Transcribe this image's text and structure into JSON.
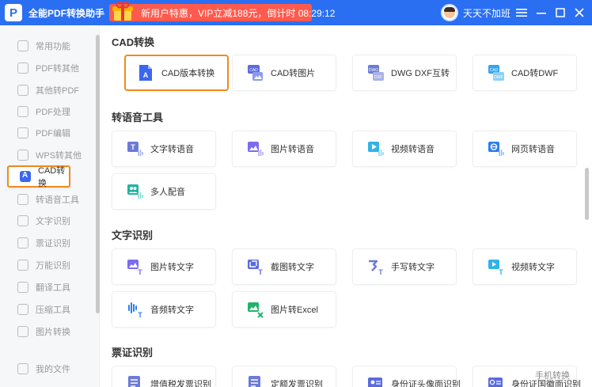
{
  "app": {
    "title": "全能PDF转换助手"
  },
  "promo": {
    "text": "新用户特惠，VIP立减188元，倒计时 08:29:12"
  },
  "user": {
    "name": "天天不加班"
  },
  "window_controls": [
    "minimize-icon",
    "maximize-icon",
    "close-icon"
  ],
  "sidebar": {
    "items": [
      {
        "label": "常用功能",
        "icon": "star-icon"
      },
      {
        "label": "PDF转其他",
        "icon": "pdf-icon"
      },
      {
        "label": "其他转PDF",
        "icon": "convert-icon"
      },
      {
        "label": "PDF处理",
        "icon": "tools-icon"
      },
      {
        "label": "PDF编辑",
        "icon": "edit-icon"
      },
      {
        "label": "WPS转其他",
        "icon": "wps-icon"
      },
      {
        "label": "CAD转换",
        "icon": "cad-icon",
        "active": true
      },
      {
        "label": "转语音工具",
        "icon": "audio-icon"
      },
      {
        "label": "文字识别",
        "icon": "text-icon"
      },
      {
        "label": "票证识别",
        "icon": "ticket-icon"
      },
      {
        "label": "万能识别",
        "icon": "scan-icon"
      },
      {
        "label": "翻译工具",
        "icon": "translate-icon"
      },
      {
        "label": "压缩工具",
        "icon": "compress-icon"
      },
      {
        "label": "图片转换",
        "icon": "image-icon"
      },
      {
        "label": "我的文件",
        "icon": "folder-icon"
      }
    ]
  },
  "sections": [
    {
      "title": "CAD转换",
      "cards": [
        {
          "label": "CAD版本转换",
          "icon": "cad-version-icon",
          "color": "#3a66f0"
        },
        {
          "label": "CAD转图片",
          "icon": "cad-to-image-icon",
          "color": "#5b6be0"
        },
        {
          "label": "DWG DXF互转",
          "icon": "dwg-dxf-icon",
          "color": "#6b7bd6"
        },
        {
          "label": "CAD转DWF",
          "icon": "cad-to-dwf-icon",
          "color": "#2fa7f0"
        }
      ]
    },
    {
      "title": "转语音工具",
      "cards": [
        {
          "label": "文字转语音",
          "icon": "text-to-speech-icon",
          "color": "#6b7bd6"
        },
        {
          "label": "图片转语音",
          "icon": "image-to-speech-icon",
          "color": "#7c6cf0"
        },
        {
          "label": "视频转语音",
          "icon": "video-to-speech-icon",
          "color": "#2fb4e8"
        },
        {
          "label": "网页转语音",
          "icon": "web-to-speech-icon",
          "color": "#2b7ff0"
        },
        {
          "label": "多人配音",
          "icon": "multi-dubbing-icon",
          "color": "#21b3a2"
        }
      ]
    },
    {
      "title": "文字识别",
      "cards": [
        {
          "label": "图片转文字",
          "icon": "image-to-text-icon",
          "color": "#7c6cf0"
        },
        {
          "label": "截图转文字",
          "icon": "screenshot-to-text-icon",
          "color": "#5b6be0"
        },
        {
          "label": "手写转文字",
          "icon": "handwriting-to-text-icon",
          "color": "#6b7bd6"
        },
        {
          "label": "视频转文字",
          "icon": "video-to-text-icon",
          "color": "#2fb4e8"
        },
        {
          "label": "音频转文字",
          "icon": "audio-to-text-icon",
          "color": "#2b7ff0"
        },
        {
          "label": "图片转Excel",
          "icon": "image-to-excel-icon",
          "color": "#23b26b"
        }
      ]
    },
    {
      "title": "票证识别",
      "cards": [
        {
          "label": "增值税发票识别",
          "icon": "invoice-icon",
          "color": "#6b7bd6"
        },
        {
          "label": "定额发票识别",
          "icon": "quota-invoice-icon",
          "color": "#6b7bd6"
        },
        {
          "label": "身份证头像面识别",
          "icon": "id-front-icon",
          "color": "#5b6be0"
        },
        {
          "label": "身份证国徽面识别",
          "icon": "id-back-icon",
          "color": "#5b6be0"
        }
      ]
    }
  ],
  "footer": {
    "phone_label": "手机转换"
  }
}
